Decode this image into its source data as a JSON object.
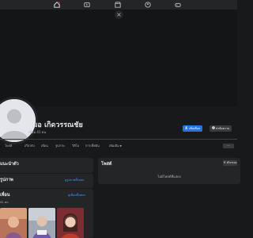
{
  "topbar": {
    "icons": [
      "home-icon",
      "video-icon",
      "marketplace-icon",
      "groups-icon",
      "gaming-icon"
    ]
  },
  "cover": {
    "close_glyph": "×"
  },
  "profile": {
    "name": "สมอ เกิดวรรณชัย",
    "friends": "เพื่อน 41 คน",
    "add_friend_label": "เพิ่มเพื่อน",
    "message_label": "ส่งข้อความ"
  },
  "tabs": [
    {
      "label": "โพสต์"
    },
    {
      "label": "เกี่ยวกับ"
    },
    {
      "label": "เพื่อน"
    },
    {
      "label": "รูปภาพ"
    },
    {
      "label": "วิดีโอ"
    },
    {
      "label": "การเช็คอิน"
    },
    {
      "label": "เพิ่มเติม"
    }
  ],
  "tabs_extra": "···",
  "intro": {
    "title": "แนะนำตัว"
  },
  "photos": {
    "title": "รูปภาพ",
    "link": "ดูรูปภาพทั้งหมด"
  },
  "friends_section": {
    "title": "เพื่อน",
    "subtitle": "41 คน",
    "link": "ดูเพื่อนทั้งหมด"
  },
  "posts": {
    "title": "โพสต์",
    "filter_label": "ตัวกรอง",
    "empty_text": "ไม่มีโพสต์ที่แสดง"
  },
  "colors": {
    "background": "#18191a",
    "surface": "#242526",
    "accent": "#2374e1",
    "link": "#4599ff"
  }
}
